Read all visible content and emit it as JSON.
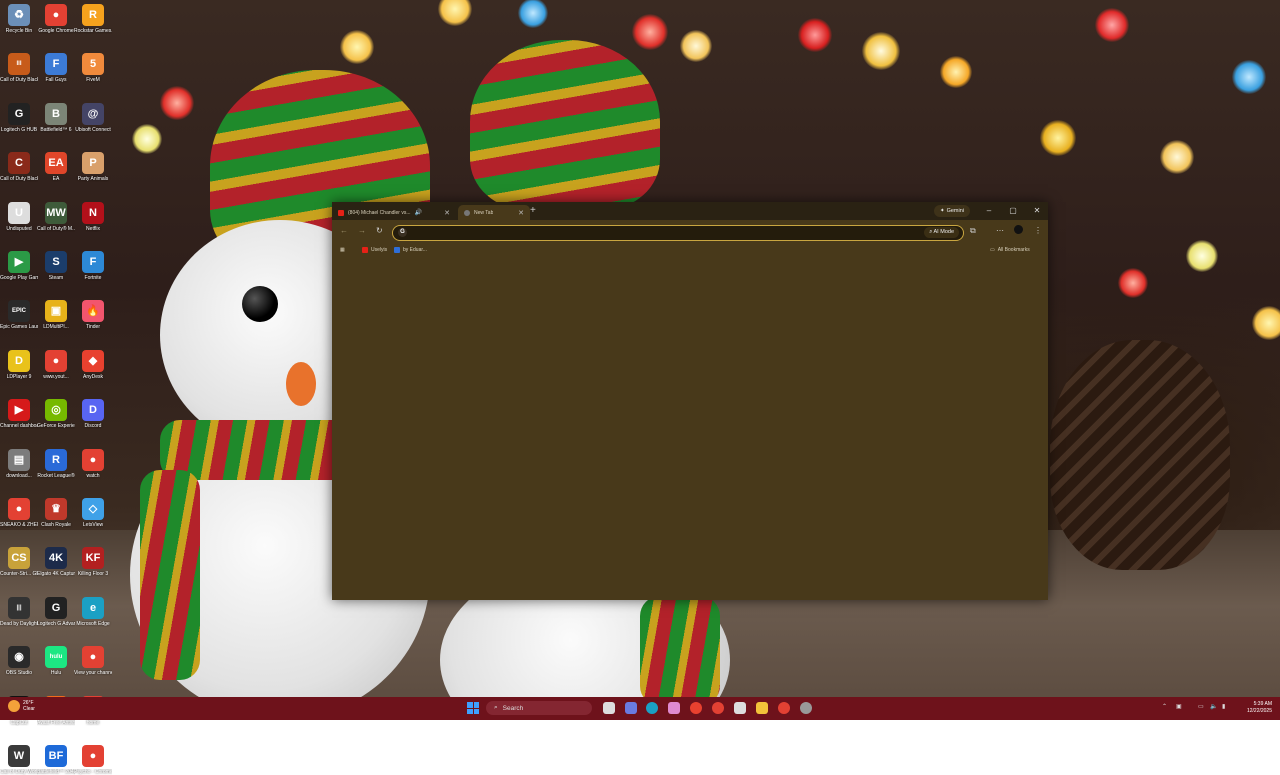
{
  "desktop": {
    "icons": [
      {
        "label": "Recycle Bin",
        "color": "#6b8fb8",
        "glyph": "♻"
      },
      {
        "label": "Google Chrome",
        "color": "#e34133",
        "glyph": "●"
      },
      {
        "label": "Rockstar Games...",
        "color": "#f6a21d",
        "glyph": "R"
      },
      {
        "label": "Call of Duty Black Ops III",
        "color": "#c75b1a",
        "glyph": "III"
      },
      {
        "label": "Fall Guys",
        "color": "#3c7bd6",
        "glyph": "F"
      },
      {
        "label": "FiveM",
        "color": "#f08a3c",
        "glyph": "5"
      },
      {
        "label": "Logitech G HUB",
        "color": "#222222",
        "glyph": "G"
      },
      {
        "label": "Battlefield™ 6",
        "color": "#7c8577",
        "glyph": "B"
      },
      {
        "label": "Ubisoft Connect",
        "color": "#444466",
        "glyph": "@"
      },
      {
        "label": "Call of Duty Black Ops...",
        "color": "#8a2a1a",
        "glyph": "C"
      },
      {
        "label": "EA",
        "color": "#e0462a",
        "glyph": "EA"
      },
      {
        "label": "Party Animals",
        "color": "#d9a06b",
        "glyph": "P"
      },
      {
        "label": "Undisputed",
        "color": "#dddddd",
        "glyph": "U"
      },
      {
        "label": "Call of Duty® M...",
        "color": "#3e5b3a",
        "glyph": "MW"
      },
      {
        "label": "Netflix",
        "color": "#b3101a",
        "glyph": "N"
      },
      {
        "label": "Google Play Games",
        "color": "#2b9a46",
        "glyph": "▶"
      },
      {
        "label": "Steam",
        "color": "#1b3d6b",
        "glyph": "S"
      },
      {
        "label": "Fortnite",
        "color": "#2d89d6",
        "glyph": "F"
      },
      {
        "label": "Epic Games Launcher",
        "color": "#2a2a2a",
        "glyph": "EPIC"
      },
      {
        "label": "LDMultiPl...",
        "color": "#e7b21a",
        "glyph": "▣"
      },
      {
        "label": "Tinder",
        "color": "#f2556d",
        "glyph": "🔥"
      },
      {
        "label": "LDPlayer 9",
        "color": "#e9c21b",
        "glyph": "D"
      },
      {
        "label": "www.yout...",
        "color": "#e34133",
        "glyph": "●"
      },
      {
        "label": "AnyDesk",
        "color": "#e8412f",
        "glyph": "◆"
      },
      {
        "label": "Channel dashboar...",
        "color": "#d61a1a",
        "glyph": "▶"
      },
      {
        "label": "GeForce Experience",
        "color": "#76b900",
        "glyph": "◎"
      },
      {
        "label": "Discord",
        "color": "#5865f2",
        "glyph": "D"
      },
      {
        "label": "download...",
        "color": "#7c7c7c",
        "glyph": "▤"
      },
      {
        "label": "Rocket League®",
        "color": "#2a6ad8",
        "glyph": "R"
      },
      {
        "label": "watch",
        "color": "#e34133",
        "glyph": "●"
      },
      {
        "label": "SNEAKO & ZHERKA Fi...",
        "color": "#e34133",
        "glyph": "●"
      },
      {
        "label": "Clash Royale",
        "color": "#c0392b",
        "glyph": "♛"
      },
      {
        "label": "LetsView",
        "color": "#3fa1e8",
        "glyph": "◇"
      },
      {
        "label": "Counter-Stri... Global Offe...",
        "color": "#c8a23a",
        "glyph": "CS"
      },
      {
        "label": "Elgato 4K Captur...",
        "color": "#1d2b4a",
        "glyph": "4K"
      },
      {
        "label": "Killing Floor 3",
        "color": "#b32020",
        "glyph": "KF"
      },
      {
        "label": "Dead by Daylight",
        "color": "#333333",
        "glyph": "|||"
      },
      {
        "label": "Logitech G Advanced...",
        "color": "#222222",
        "glyph": "G"
      },
      {
        "label": "Microsoft Edge",
        "color": "#1ba0c4",
        "glyph": "e"
      },
      {
        "label": "OBS Studio",
        "color": "#2a2a2a",
        "glyph": "◉"
      },
      {
        "label": "Hulu",
        "color": "#1ce783",
        "glyph": "hulu"
      },
      {
        "label": "View your channel",
        "color": "#e34133",
        "glyph": "●"
      },
      {
        "label": "CapCut",
        "color": "#111111",
        "glyph": "✂"
      },
      {
        "label": "Avast Free Antivirus",
        "color": "#f26a1b",
        "glyph": "a"
      },
      {
        "label": "home",
        "color": "#e34133",
        "glyph": "●"
      },
      {
        "label": "Call of Duty World at War",
        "color": "#3a3a3a",
        "glyph": "W"
      },
      {
        "label": "Battlefield™ 2042",
        "color": "#1e6ad8",
        "glyph": "BF"
      },
      {
        "label": "Psycho - Chrome",
        "color": "#e34133",
        "glyph": "●"
      }
    ]
  },
  "browser": {
    "tabs": [
      {
        "title": "(804) Michael Chandler vs...",
        "favicon_color": "#e62117",
        "active": false
      },
      {
        "title": "New Tab",
        "favicon_color": "#777777",
        "active": true
      }
    ],
    "gemini_label": "Gemini",
    "omnibox": {
      "value": "",
      "ai_mode_label": "AI Mode"
    },
    "bookmarks": [
      {
        "label": "Uselyis",
        "favicon_color": "#e62117"
      },
      {
        "label": "by Eduar...",
        "favicon_color": "#2f6fd8"
      }
    ],
    "all_bookmarks_label": "All Bookmarks",
    "theme_color": "#48391a"
  },
  "taskbar": {
    "weather": {
      "temp": "26°F",
      "condition": "Clear"
    },
    "search_label": "Search",
    "clock": {
      "time": "5:39 AM",
      "date": "12/22/2025"
    },
    "color": "#6e121b"
  }
}
